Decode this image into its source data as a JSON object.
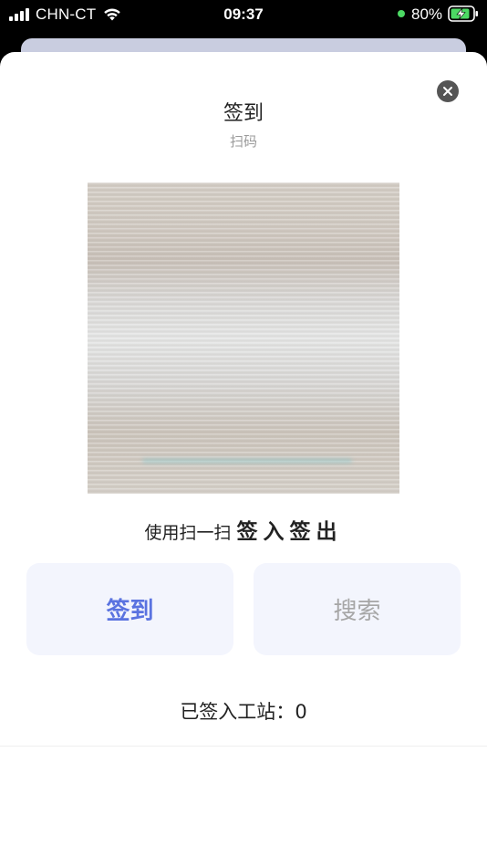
{
  "status_bar": {
    "carrier": "CHN-CT",
    "time": "09:37",
    "battery_percent": "80%",
    "charging_indicator_color": "#4cd964"
  },
  "modal": {
    "title": "签到",
    "subtitle": "扫码",
    "close_icon": "close-icon",
    "hint_prefix": "使用扫一扫",
    "hint_actions": "签入签出",
    "buttons": {
      "checkin_label": "签到",
      "search_label": "搜索"
    },
    "stats_label": "已签入工站：",
    "stats_value": "0"
  },
  "colors": {
    "accent": "#5a73e0",
    "button_bg": "#f3f5fd",
    "disabled_text": "#a6a6a6"
  }
}
